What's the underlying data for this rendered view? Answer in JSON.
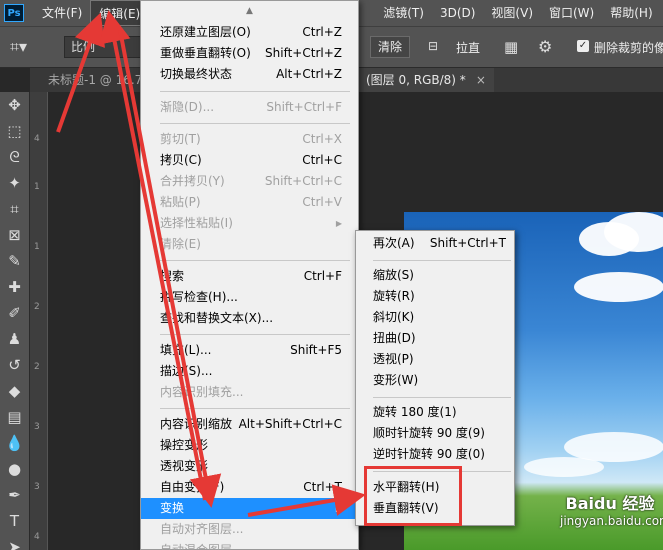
{
  "app": {
    "logo": "Ps"
  },
  "menubar": {
    "items": [
      {
        "label": "文件(F)"
      },
      {
        "label": "编辑(E)"
      },
      {
        "label": "滤镜(T)"
      },
      {
        "label": "3D(D)"
      },
      {
        "label": "视图(V)"
      },
      {
        "label": "窗口(W)"
      },
      {
        "label": "帮助(H)"
      }
    ]
  },
  "options_bar": {
    "ratio": "比例",
    "clear_label": "清除",
    "straighten_label": "拉直",
    "delete_cropped_label": "删除裁剪的像"
  },
  "tabs": {
    "tab1": "未标题-1 @ 16.7%",
    "tab2": "(图层 0, RGB/8) *",
    "tab2_close": "×"
  },
  "ruler": {
    "marks": [
      "4",
      "1",
      "1",
      "2",
      "2",
      "3",
      "3",
      "4"
    ]
  },
  "edit_menu": {
    "items": [
      {
        "label": "还原建立图层(O)",
        "shortcut": "Ctrl+Z"
      },
      {
        "label": "重做垂直翻转(O)",
        "shortcut": "Shift+Ctrl+Z"
      },
      {
        "label": "切换最终状态",
        "shortcut": "Alt+Ctrl+Z"
      },
      {
        "label": "渐隐(D)...",
        "shortcut": "Shift+Ctrl+F"
      },
      {
        "label": "剪切(T)",
        "shortcut": "Ctrl+X"
      },
      {
        "label": "拷贝(C)",
        "shortcut": "Ctrl+C"
      },
      {
        "label": "合并拷贝(Y)",
        "shortcut": "Shift+Ctrl+C"
      },
      {
        "label": "粘贴(P)",
        "shortcut": "Ctrl+V"
      },
      {
        "label": "选择性粘贴(I)",
        "shortcut": "▶"
      },
      {
        "label": "清除(E)",
        "shortcut": ""
      },
      {
        "label": "搜索",
        "shortcut": "Ctrl+F"
      },
      {
        "label": "拼写检查(H)...",
        "shortcut": ""
      },
      {
        "label": "查找和替换文本(X)...",
        "shortcut": ""
      },
      {
        "label": "填充(L)...",
        "shortcut": "Shift+F5"
      },
      {
        "label": "描边(S)...",
        "shortcut": ""
      },
      {
        "label": "内容识别填充...",
        "shortcut": ""
      },
      {
        "label": "内容识别缩放",
        "shortcut": "Alt+Shift+Ctrl+C"
      },
      {
        "label": "操控变形",
        "shortcut": ""
      },
      {
        "label": "透视变形",
        "shortcut": ""
      },
      {
        "label": "自由变换(F)",
        "shortcut": "Ctrl+T"
      },
      {
        "label": "变换",
        "shortcut": "▶"
      },
      {
        "label": "自动对齐图层...",
        "shortcut": ""
      },
      {
        "label": "自动混合图层...",
        "shortcut": ""
      }
    ]
  },
  "transform_submenu": {
    "items": [
      {
        "label": "再次(A)",
        "shortcut": "Shift+Ctrl+T"
      },
      {
        "label": "缩放(S)",
        "shortcut": ""
      },
      {
        "label": "旋转(R)",
        "shortcut": ""
      },
      {
        "label": "斜切(K)",
        "shortcut": ""
      },
      {
        "label": "扭曲(D)",
        "shortcut": ""
      },
      {
        "label": "透视(P)",
        "shortcut": ""
      },
      {
        "label": "变形(W)",
        "shortcut": ""
      },
      {
        "label": "旋转 180 度(1)",
        "shortcut": ""
      },
      {
        "label": "顺时针旋转 90 度(9)",
        "shortcut": ""
      },
      {
        "label": "逆时针旋转 90 度(0)",
        "shortcut": ""
      },
      {
        "label": "水平翻转(H)",
        "shortcut": ""
      },
      {
        "label": "垂直翻转(V)",
        "shortcut": ""
      }
    ]
  },
  "watermark": {
    "logo": "Baidu 经验",
    "url": "jingyan.baidu.com"
  },
  "colors": {
    "highlight": "#1e90ff",
    "annotation": "#e53935"
  }
}
